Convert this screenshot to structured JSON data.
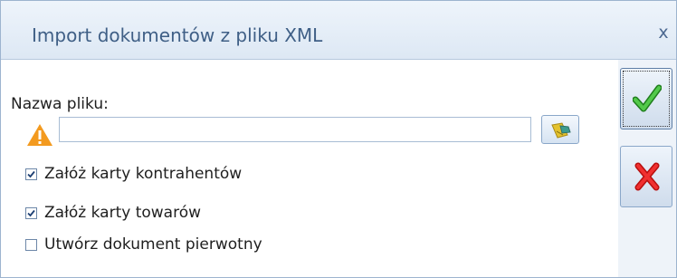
{
  "window": {
    "title": "Import dokumentów z pliku XML",
    "close_label": "x"
  },
  "form": {
    "file_label": "Nazwa pliku:",
    "file_value": "",
    "file_placeholder": ""
  },
  "options": [
    {
      "label": "Załóż karty kontrahentów",
      "checked": true
    },
    {
      "label": "Załóż karty towarów",
      "checked": true
    },
    {
      "label": "Utwórz dokument pierwotny",
      "checked": false
    }
  ],
  "icons": {
    "warning": "warning-icon",
    "browse": "folder-icon",
    "confirm": "checkmark-icon",
    "cancel": "x-icon"
  },
  "colors": {
    "title_text": "#3f5f86",
    "warning": "#f39a1f",
    "confirm": "#2ea12b",
    "cancel": "#e11c1c"
  }
}
